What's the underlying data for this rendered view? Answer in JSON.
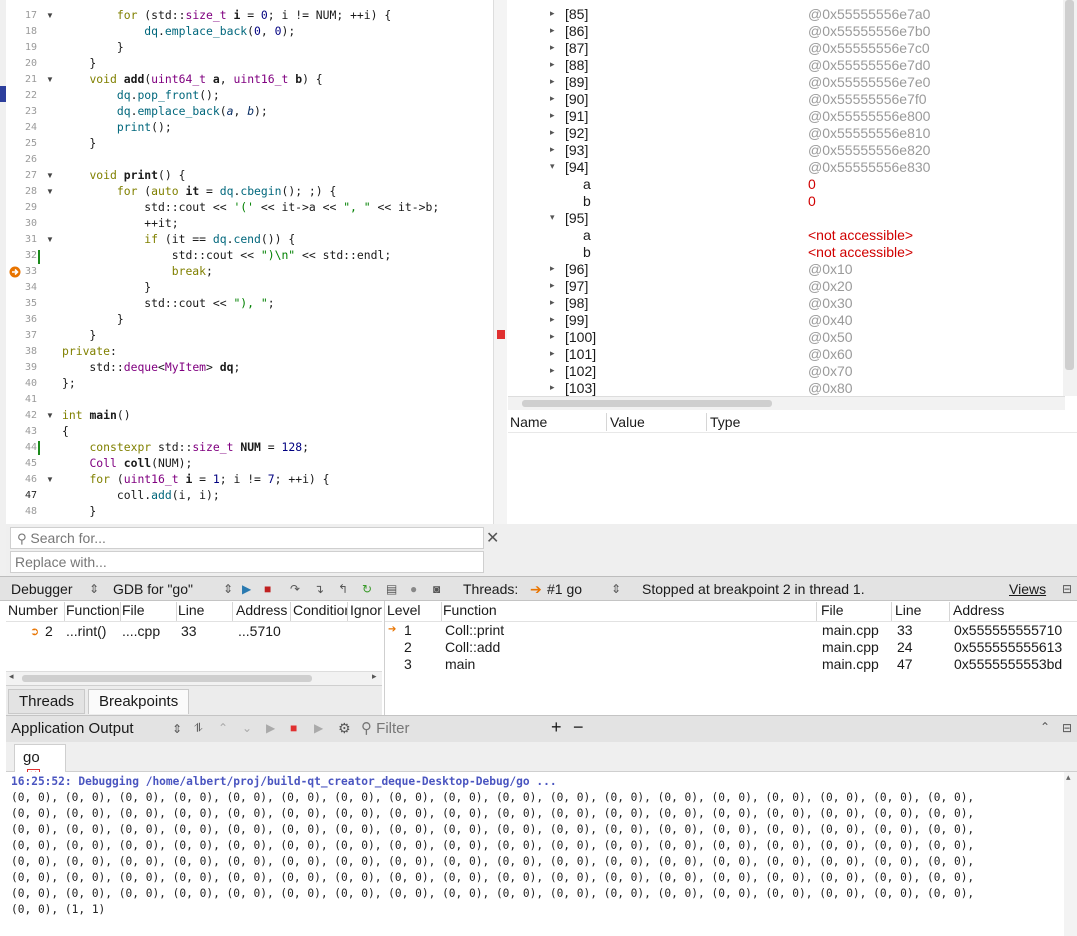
{
  "editor": {
    "lines": [
      {
        "n": "17",
        "html": "        <span class='kw'>for</span> (std::<span class='ty'>size_t</span> <span class='bd'>i</span> = <span class='nm'>0</span>; i != NUM; ++i) {"
      },
      {
        "n": "18",
        "html": "            <span class='fn'>dq</span>.<span class='fn'>emplace_back</span>(<span class='nm'>0</span>, <span class='nm'>0</span>);"
      },
      {
        "n": "19",
        "html": "        }"
      },
      {
        "n": "20",
        "html": "    }"
      },
      {
        "n": "21",
        "html": "    <span class='kw'>void</span> <span class='bd'>add</span>(<span class='ty'>uint64_t</span> <span class='bd'>a</span>, <span class='ty'>uint16_t</span> <span class='bd'>b</span>) {"
      },
      {
        "n": "22",
        "html": "        <span class='fn'>dq</span>.<span class='fn'>pop_front</span>();"
      },
      {
        "n": "23",
        "html": "        <span class='fn'>dq</span>.<span class='fn'>emplace_back</span>(<span class='it'>a</span>, <span class='it'>b</span>);"
      },
      {
        "n": "24",
        "html": "        <span class='fn'>print</span>();"
      },
      {
        "n": "25",
        "html": "    }"
      },
      {
        "n": "26",
        "html": ""
      },
      {
        "n": "27",
        "html": "    <span class='kw'>void</span> <span class='bd'>print</span>() {"
      },
      {
        "n": "28",
        "html": "        <span class='kw'>for</span> (<span class='kw'>auto</span> <span class='bd'>it</span> = <span class='fn'>dq</span>.<span class='fn'>cbegin</span>(); ;) {"
      },
      {
        "n": "29",
        "html": "            std::cout << <span class='st'>'('</span> << it->a << <span class='st'>\", \"</span> << it->b;"
      },
      {
        "n": "30",
        "html": "            ++it;"
      },
      {
        "n": "31",
        "html": "            <span class='kw'>if</span> (it == <span class='fn'>dq</span>.<span class='fn'>cend</span>()) {"
      },
      {
        "n": "32",
        "html": "                std::cout << <span class='st'>\")\\n\"</span> << std::endl;"
      },
      {
        "n": "33",
        "html": "                <span class='kw'>break</span>;"
      },
      {
        "n": "34",
        "html": "            }"
      },
      {
        "n": "35",
        "html": "            std::cout << <span class='st'>\"), \"</span>;"
      },
      {
        "n": "36",
        "html": "        }"
      },
      {
        "n": "37",
        "html": "    }"
      },
      {
        "n": "38",
        "html": "<span class='kw'>private</span>:"
      },
      {
        "n": "39",
        "html": "    std::<span class='ty'>deque</span><<span class='ty'>MyItem</span>> <span class='bd'>dq</span>;"
      },
      {
        "n": "40",
        "html": "};"
      },
      {
        "n": "41",
        "html": ""
      },
      {
        "n": "42",
        "html": "<span class='kw'>int</span> <span class='bd'>main</span>()"
      },
      {
        "n": "43",
        "html": "{"
      },
      {
        "n": "44",
        "html": "    <span class='kw'>constexpr</span> std::<span class='ty'>size_t</span> <span class='bd'>NUM</span> = <span class='nm'>128</span>;"
      },
      {
        "n": "45",
        "html": "    <span class='ty'>Coll</span> <span class='bd'>coll</span>(NUM);"
      },
      {
        "n": "46",
        "html": "    <span class='kw'>for</span> (<span class='ty'>uint16_t</span> <span class='bd'>i</span> = <span class='nm'>1</span>; i != <span class='nm'>7</span>; ++i) {"
      },
      {
        "n": "47",
        "html": "        coll.<span class='fn'>add</span>(i, i);"
      },
      {
        "n": "48",
        "html": "    }"
      }
    ]
  },
  "search": {
    "find_placeholder": "Search for...",
    "replace_placeholder": "Replace with..."
  },
  "locals": {
    "rows": [
      {
        "name": "[85]",
        "value": "@0x55555556e7a0",
        "arrow": "▸",
        "indent": 0,
        "red": false
      },
      {
        "name": "[86]",
        "value": "@0x55555556e7b0",
        "arrow": "▸",
        "indent": 0,
        "red": false
      },
      {
        "name": "[87]",
        "value": "@0x55555556e7c0",
        "arrow": "▸",
        "indent": 0,
        "red": false
      },
      {
        "name": "[88]",
        "value": "@0x55555556e7d0",
        "arrow": "▸",
        "indent": 0,
        "red": false
      },
      {
        "name": "[89]",
        "value": "@0x55555556e7e0",
        "arrow": "▸",
        "indent": 0,
        "red": false
      },
      {
        "name": "[90]",
        "value": "@0x55555556e7f0",
        "arrow": "▸",
        "indent": 0,
        "red": false
      },
      {
        "name": "[91]",
        "value": "@0x55555556e800",
        "arrow": "▸",
        "indent": 0,
        "red": false
      },
      {
        "name": "[92]",
        "value": "@0x55555556e810",
        "arrow": "▸",
        "indent": 0,
        "red": false
      },
      {
        "name": "[93]",
        "value": "@0x55555556e820",
        "arrow": "▸",
        "indent": 0,
        "red": false
      },
      {
        "name": "[94]",
        "value": "@0x55555556e830",
        "arrow": "▾",
        "indent": 0,
        "red": false
      },
      {
        "name": "a",
        "value": "0",
        "arrow": "",
        "indent": 1,
        "red": true
      },
      {
        "name": "b",
        "value": "0",
        "arrow": "",
        "indent": 1,
        "red": true
      },
      {
        "name": "[95]",
        "value": "",
        "arrow": "▾",
        "indent": 0,
        "red": false
      },
      {
        "name": "a",
        "value": "<not accessible>",
        "arrow": "",
        "indent": 1,
        "red": true
      },
      {
        "name": "b",
        "value": "<not accessible>",
        "arrow": "",
        "indent": 1,
        "red": true
      },
      {
        "name": "[96]",
        "value": "@0x10",
        "arrow": "▸",
        "indent": 0,
        "red": false
      },
      {
        "name": "[97]",
        "value": "@0x20",
        "arrow": "▸",
        "indent": 0,
        "red": false
      },
      {
        "name": "[98]",
        "value": "@0x30",
        "arrow": "▸",
        "indent": 0,
        "red": false
      },
      {
        "name": "[99]",
        "value": "@0x40",
        "arrow": "▸",
        "indent": 0,
        "red": false
      },
      {
        "name": "[100]",
        "value": "@0x50",
        "arrow": "▸",
        "indent": 0,
        "red": false
      },
      {
        "name": "[101]",
        "value": "@0x60",
        "arrow": "▸",
        "indent": 0,
        "red": false
      },
      {
        "name": "[102]",
        "value": "@0x70",
        "arrow": "▸",
        "indent": 0,
        "red": false
      },
      {
        "name": "[103]",
        "value": "@0x80",
        "arrow": "▸",
        "indent": 0,
        "red": false
      }
    ]
  },
  "expressions": {
    "col_name": "Name",
    "col_value": "Value",
    "col_type": "Type"
  },
  "toolbar": {
    "debugger_label": "Debugger",
    "engine_label": "GDB for \"go\"",
    "threads_label": "Threads:",
    "thread_value": "#1 go",
    "status": "Stopped at breakpoint 2 in thread 1.",
    "views_label": "Views"
  },
  "breakpoints": {
    "headers": [
      "Number",
      "Function",
      "File",
      "Line",
      "Address",
      "Condition",
      "Ignore"
    ],
    "row": {
      "number": "2",
      "function": "...rint()",
      "file": "....cpp",
      "line": "33",
      "address": "...5710"
    },
    "tab_threads": "Threads",
    "tab_breakpoints": "Breakpoints"
  },
  "stack": {
    "headers": [
      "Level",
      "Function",
      "File",
      "Line",
      "Address"
    ],
    "rows": [
      {
        "level": "1",
        "function": "Coll::print",
        "file": "main.cpp",
        "line": "33",
        "address": "0x555555555710"
      },
      {
        "level": "2",
        "function": "Coll::add",
        "file": "main.cpp",
        "line": "24",
        "address": "0x555555555613"
      },
      {
        "level": "3",
        "function": "main",
        "file": "main.cpp",
        "line": "47",
        "address": "0x5555555553bd"
      }
    ]
  },
  "output": {
    "pane_title": "Application Output",
    "filter_placeholder": "Filter",
    "tab_label": "go",
    "header_line": "16:25:52: Debugging /home/albert/proj/build-qt_creator_deque-Desktop-Debug/go ...",
    "lines": [
      "(0, 0), (0, 0), (0, 0), (0, 0), (0, 0), (0, 0), (0, 0), (0, 0), (0, 0), (0, 0), (0, 0), (0, 0), (0, 0), (0, 0), (0, 0), (0, 0), (0, 0), (0, 0),",
      "(0, 0), (0, 0), (0, 0), (0, 0), (0, 0), (0, 0), (0, 0), (0, 0), (0, 0), (0, 0), (0, 0), (0, 0), (0, 0), (0, 0), (0, 0), (0, 0), (0, 0), (0, 0),",
      "(0, 0), (0, 0), (0, 0), (0, 0), (0, 0), (0, 0), (0, 0), (0, 0), (0, 0), (0, 0), (0, 0), (0, 0), (0, 0), (0, 0), (0, 0), (0, 0), (0, 0), (0, 0),",
      "(0, 0), (0, 0), (0, 0), (0, 0), (0, 0), (0, 0), (0, 0), (0, 0), (0, 0), (0, 0), (0, 0), (0, 0), (0, 0), (0, 0), (0, 0), (0, 0), (0, 0), (0, 0),",
      "(0, 0), (0, 0), (0, 0), (0, 0), (0, 0), (0, 0), (0, 0), (0, 0), (0, 0), (0, 0), (0, 0), (0, 0), (0, 0), (0, 0), (0, 0), (0, 0), (0, 0), (0, 0),",
      "(0, 0), (0, 0), (0, 0), (0, 0), (0, 0), (0, 0), (0, 0), (0, 0), (0, 0), (0, 0), (0, 0), (0, 0), (0, 0), (0, 0), (0, 0), (0, 0), (0, 0), (0, 0),",
      "(0, 0), (0, 0), (0, 0), (0, 0), (0, 0), (0, 0), (0, 0), (0, 0), (0, 0), (0, 0), (0, 0), (0, 0), (0, 0), (0, 0), (0, 0), (0, 0), (0, 0), (0, 0),",
      "(0, 0), (1, 1)"
    ]
  },
  "colors": {
    "accent": "#2c3e9c",
    "error_red": "#d00000",
    "stop_red": "#e03030",
    "breakpoint_orange": "#e87400"
  }
}
